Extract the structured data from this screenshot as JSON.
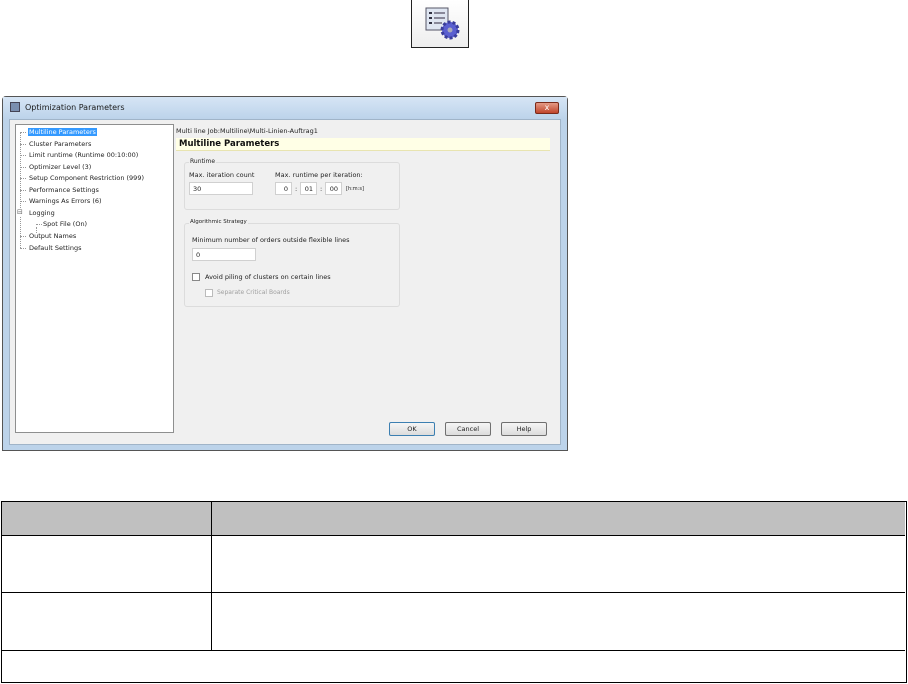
{
  "toolbar_icon": "settings-list-gear-icon",
  "dialog": {
    "title": "Optimization Parameters",
    "close_label": "x",
    "tree": [
      {
        "label": "Multiline Parameters",
        "selected": true
      },
      {
        "label": "Cluster Parameters"
      },
      {
        "label": "Limit runtime (Runtime 00:10:00)"
      },
      {
        "label": "Optimizer Level (3)"
      },
      {
        "label": "Setup Component Restriction (999)"
      },
      {
        "label": "Performance Settings"
      },
      {
        "label": "Warnings As Errors (6)"
      },
      {
        "label": "Logging",
        "expander": "⊟"
      },
      {
        "label": "Spot File (On)"
      },
      {
        "label": "Output Names"
      },
      {
        "label": "Default Settings"
      }
    ],
    "job_path": "Multi line Job:Multiline\\Multi-Linien-Auftrag1",
    "section_title": "Multiline Parameters",
    "runtime": {
      "group_label": "Runtime",
      "max_iter_label": "Max. iteration count",
      "max_iter_value": "30",
      "max_runtime_label": "Max. runtime per iteration:",
      "h": "0",
      "m": "01",
      "s": "00",
      "sep": ":",
      "unit": "[h:m:s]"
    },
    "strategy": {
      "group_label": "Algorithmic Strategy",
      "min_orders_label": "Minimum number of orders outside flexible lines",
      "min_orders_value": "0",
      "avoid_piling_label": "Avoid piling of clusters on certain lines",
      "avoid_piling_checked": false,
      "separate_label": "Separate Critical Boards",
      "separate_checked": false
    },
    "buttons": {
      "ok": "OK",
      "cancel": "Cancel",
      "help": "Help"
    }
  },
  "table": {
    "header": [
      "",
      ""
    ],
    "rows": [
      [
        "",
        ""
      ],
      [
        "",
        ""
      ]
    ],
    "footer": ""
  }
}
